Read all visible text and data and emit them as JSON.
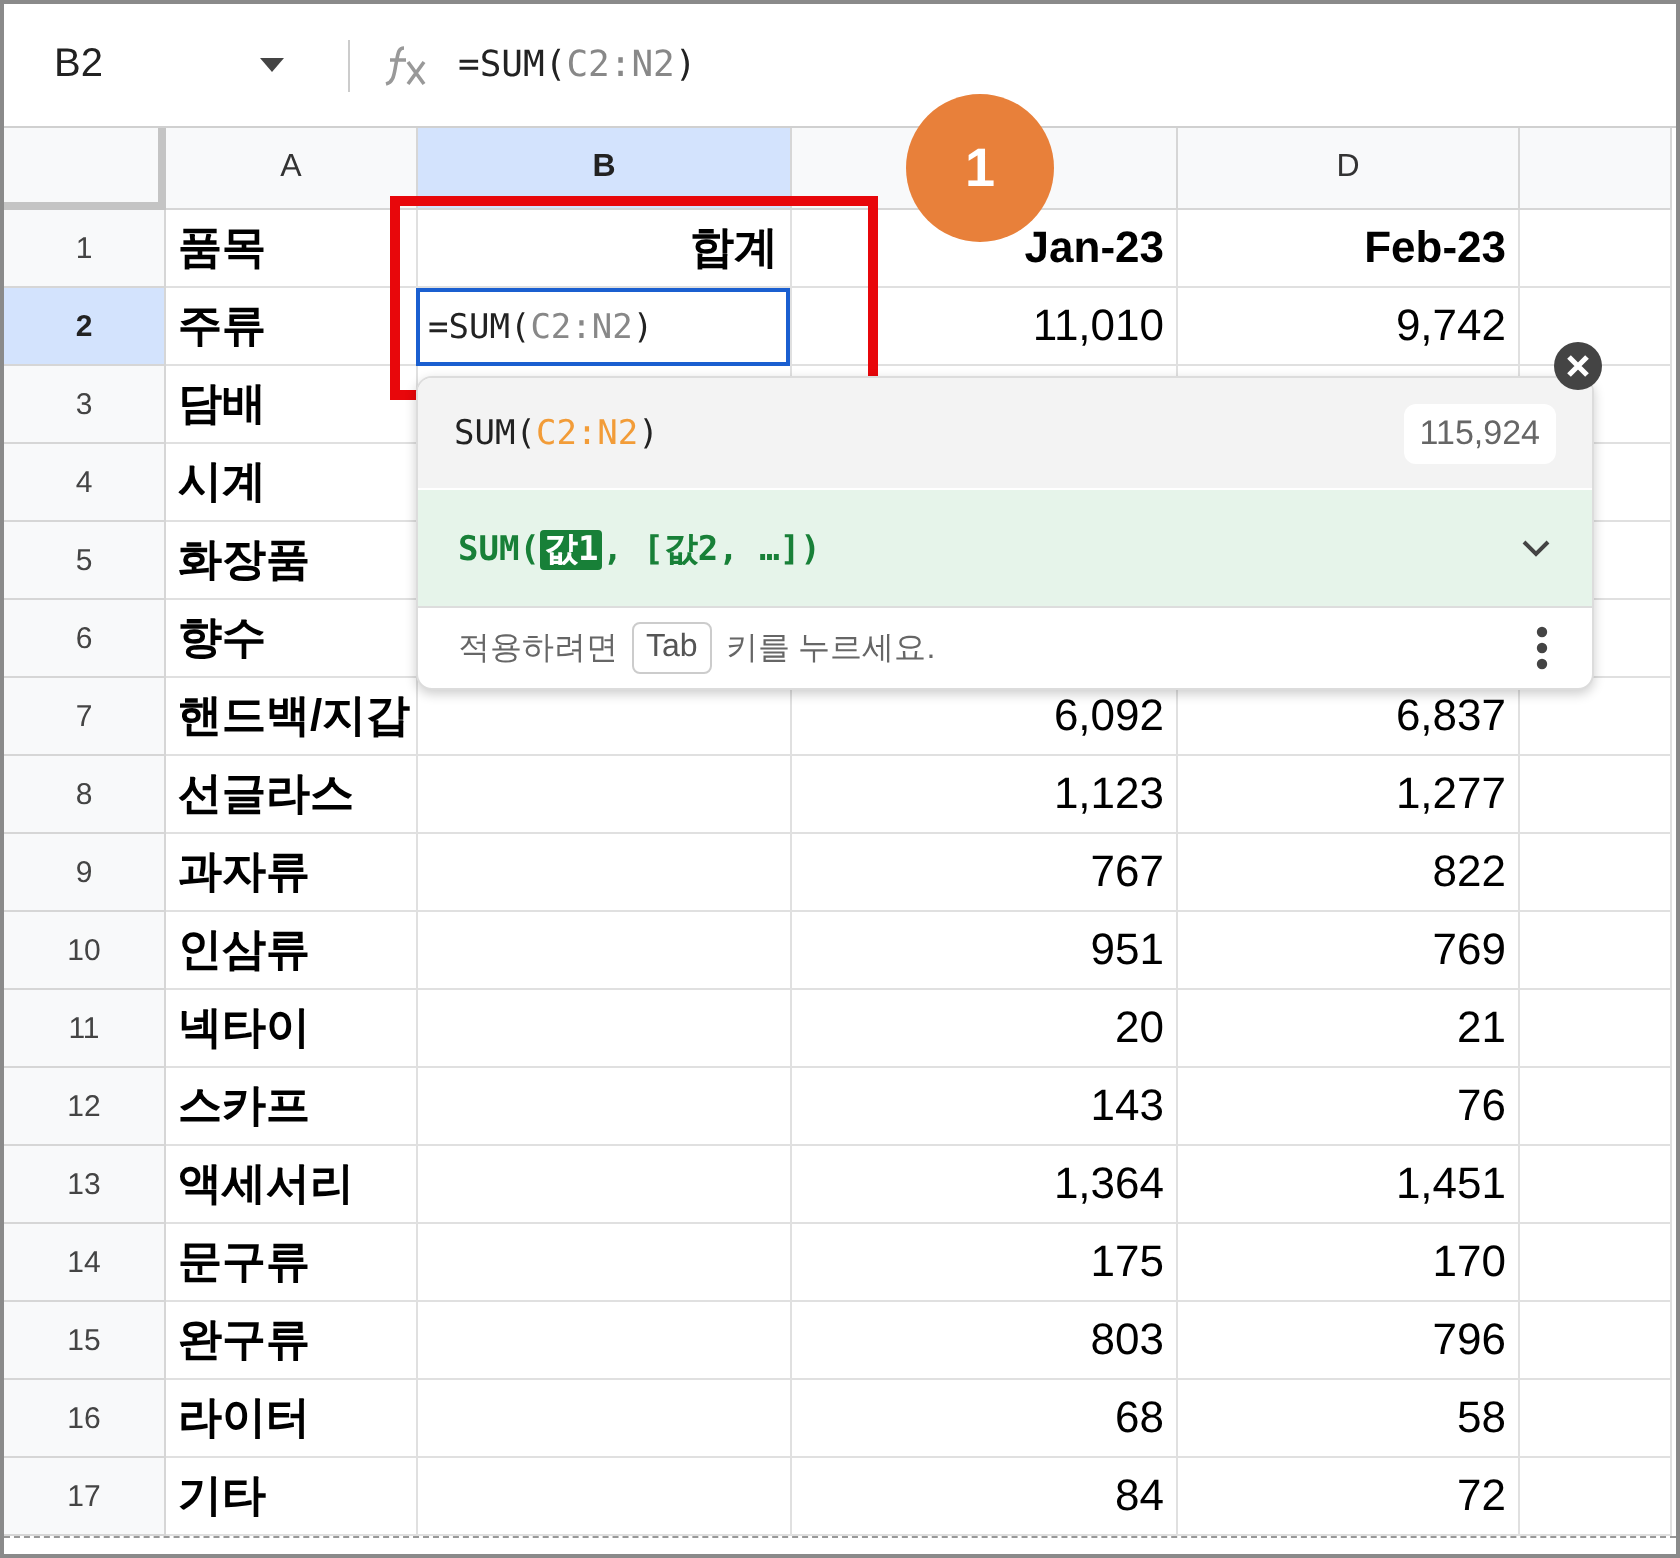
{
  "formula_bar": {
    "name_box": "B2",
    "formula": [
      {
        "text": "=SUM(",
        "kind": "fn"
      },
      {
        "text": "C2:N2",
        "kind": "ref"
      },
      {
        "text": ")",
        "kind": "fn"
      }
    ]
  },
  "columns": [
    {
      "label": "A",
      "selected": false
    },
    {
      "label": "B",
      "selected": true
    },
    {
      "selected": false
    },
    {
      "label": "D",
      "selected": false
    },
    {
      "selected": false
    }
  ],
  "rows": [
    {
      "number": "1",
      "selected": false,
      "kind": "header",
      "a": "품목",
      "b": "합계",
      "c": "Jan-23",
      "d": "Feb-23"
    },
    {
      "number": "2",
      "selected": true,
      "kind": "data",
      "a": "주류",
      "editing": true,
      "c": "11,010",
      "d": "9,742"
    },
    {
      "number": "3",
      "selected": false,
      "kind": "data",
      "a": "담배"
    },
    {
      "number": "4",
      "selected": false,
      "kind": "data",
      "a": "시계"
    },
    {
      "number": "5",
      "selected": false,
      "kind": "data",
      "a": "화장품"
    },
    {
      "number": "6",
      "selected": false,
      "kind": "data",
      "a": "향수"
    },
    {
      "number": "7",
      "selected": false,
      "kind": "data",
      "a": "핸드백/지갑",
      "c": "6,092",
      "d": "6,837"
    },
    {
      "number": "8",
      "selected": false,
      "kind": "data",
      "a": "선글라스",
      "c": "1,123",
      "d": "1,277"
    },
    {
      "number": "9",
      "selected": false,
      "kind": "data",
      "a": "과자류",
      "c": "767",
      "d": "822"
    },
    {
      "number": "10",
      "selected": false,
      "kind": "data",
      "a": "인삼류",
      "c": "951",
      "d": "769"
    },
    {
      "number": "11",
      "selected": false,
      "kind": "data",
      "a": "넥타이",
      "c": "20",
      "d": "21"
    },
    {
      "number": "12",
      "selected": false,
      "kind": "data",
      "a": "스카프",
      "c": "143",
      "d": "76"
    },
    {
      "number": "13",
      "selected": false,
      "kind": "data",
      "a": "액세서리",
      "c": "1,364",
      "d": "1,451"
    },
    {
      "number": "14",
      "selected": false,
      "kind": "data",
      "a": "문구류",
      "c": "175",
      "d": "170"
    },
    {
      "number": "15",
      "selected": false,
      "kind": "data",
      "a": "완구류",
      "c": "803",
      "d": "796"
    },
    {
      "number": "16",
      "selected": false,
      "kind": "data",
      "a": "라이터",
      "c": "68",
      "d": "58"
    },
    {
      "number": "17",
      "selected": false,
      "kind": "data",
      "a": "기타",
      "c": "84",
      "d": "72"
    }
  ],
  "editor": [
    {
      "text": "=SUM(",
      "kind": "fn"
    },
    {
      "text": "C2:N2",
      "kind": "ref"
    },
    {
      "text": ")",
      "kind": "fn"
    }
  ],
  "suggestion": {
    "formula": [
      {
        "text": "SUM(",
        "kind": "fn"
      },
      {
        "text": "C2:N2",
        "kind": "ref"
      },
      {
        "text": ")",
        "kind": "fn"
      }
    ],
    "result": "115,924",
    "signature": [
      {
        "text": "SUM(",
        "kind": "fn"
      },
      {
        "text": "값1",
        "kind": "active"
      },
      {
        "text": ", [값2, …])",
        "kind": "fn"
      }
    ],
    "hint_before": "적용하려면",
    "key": "Tab",
    "hint_after": "키를 누르세요."
  },
  "badge": "1"
}
